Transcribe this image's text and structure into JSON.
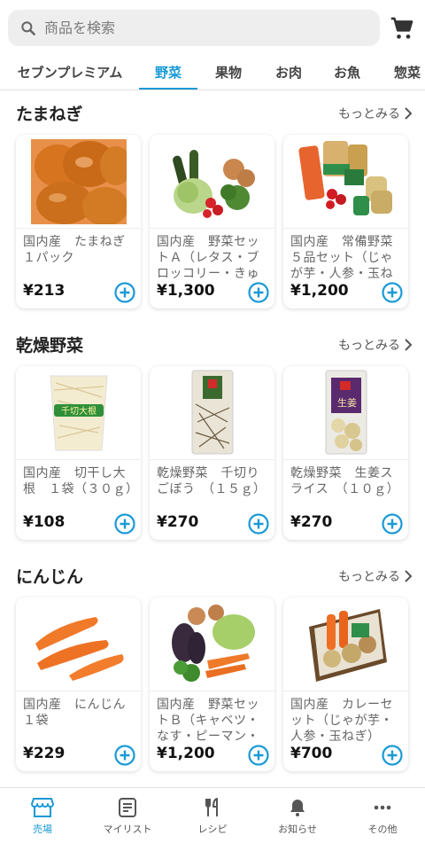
{
  "search": {
    "placeholder": "商品を検索"
  },
  "colors": {
    "accent": "#1a9ad6",
    "text": "#222222",
    "muted": "#666666"
  },
  "tabs": [
    {
      "label": "セブンプレミアム",
      "active": false
    },
    {
      "label": "野菜",
      "active": true
    },
    {
      "label": "果物",
      "active": false
    },
    {
      "label": "お肉",
      "active": false
    },
    {
      "label": "お魚",
      "active": false
    },
    {
      "label": "惣菜",
      "active": false
    }
  ],
  "more_label": "もっとみる",
  "sections": [
    {
      "title": "たまねぎ",
      "products": [
        {
          "name": "国内産　たまねぎ１パック",
          "price": "¥213",
          "icon": "onion-image"
        },
        {
          "name": "国内産　野菜セットＡ（レタス・ブロッコリー・きゅ",
          "price": "¥1,300",
          "icon": "vegetable-set-image"
        },
        {
          "name": "国内産　常備野菜５品セット（じゃが芋・人参・玉ね",
          "price": "¥1,200",
          "icon": "vegetable-pack-image"
        }
      ]
    },
    {
      "title": "乾燥野菜",
      "products": [
        {
          "name": "国内産　切干し大根　１袋（３０ｇ）",
          "price": "¥108",
          "icon": "dried-radish-image"
        },
        {
          "name": "乾燥野菜　千切りごぼう　（１５ｇ）",
          "price": "¥270",
          "icon": "dried-burdock-image"
        },
        {
          "name": "乾燥野菜　生姜スライス　（１０ｇ）",
          "price": "¥270",
          "icon": "dried-ginger-image"
        }
      ]
    },
    {
      "title": "にんじん",
      "products": [
        {
          "name": "国内産　にんじん１袋",
          "price": "¥229",
          "icon": "carrot-image"
        },
        {
          "name": "国内産　野菜セットＢ（キャベツ・なす・ピーマン・",
          "price": "¥1,200",
          "icon": "vegetable-set-b-image"
        },
        {
          "name": "国内産　カレーセット（じゃが芋・人参・玉ねぎ）",
          "price": "¥700",
          "icon": "curry-set-image"
        }
      ]
    }
  ],
  "nav": [
    {
      "label": "売場",
      "icon": "store-icon",
      "active": true
    },
    {
      "label": "マイリスト",
      "icon": "list-icon",
      "active": false
    },
    {
      "label": "レシピ",
      "icon": "cutlery-icon",
      "active": false
    },
    {
      "label": "お知らせ",
      "icon": "bell-icon",
      "active": false
    },
    {
      "label": "その他",
      "icon": "more-icon",
      "active": false
    }
  ]
}
